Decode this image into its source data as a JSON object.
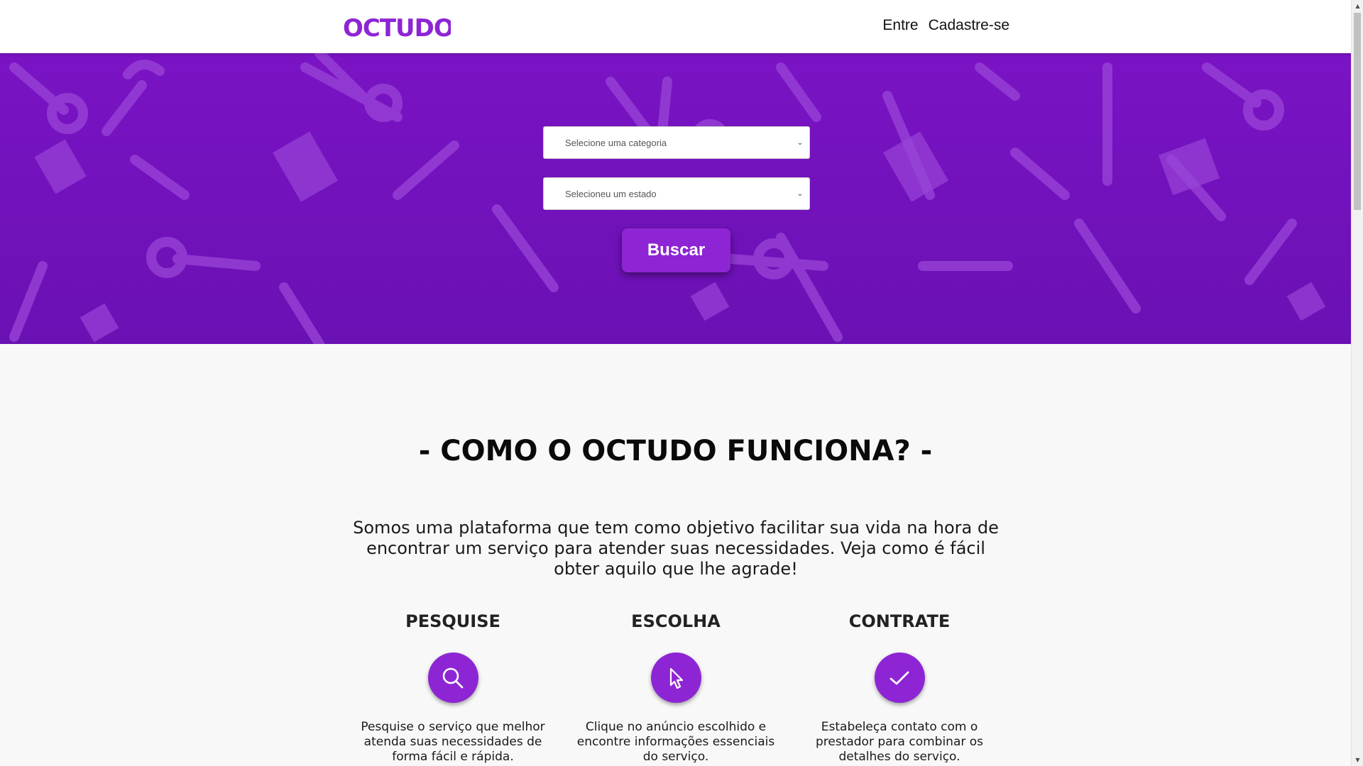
{
  "header": {
    "logo_text": "OCTUDO",
    "nav": [
      {
        "label": "Entre"
      },
      {
        "label": "Cadastre-se"
      }
    ]
  },
  "hero": {
    "category_select": {
      "value": "Selecione uma categoria"
    },
    "state_select": {
      "value": "Selecioneu um estado"
    },
    "search_button": "Buscar"
  },
  "how": {
    "title": "- COMO O OCTUDO FUNCIONA? -",
    "intro": "Somos uma plataforma que tem como objetivo facilitar sua vida na hora de encontrar um serviço para atender suas necessidades. Veja como é fácil obter aquilo que lhe agrade!",
    "steps": [
      {
        "title": "PESQUISE",
        "icon": "search-icon",
        "text": "Pesquise o serviço que melhor atenda suas necessidades de forma fácil e rápida."
      },
      {
        "title": "ESCOLHA",
        "icon": "cursor-icon",
        "text": "Clique no anúncio escolhido e encontre informações essenciais do serviço."
      },
      {
        "title": "CONTRATE",
        "icon": "check-icon",
        "text": "Estabeleça contato com o prestador para combinar os detalhes do serviço."
      }
    ]
  },
  "colors": {
    "brand": "#8e25d4",
    "hero_bg": "#7a13c4"
  }
}
